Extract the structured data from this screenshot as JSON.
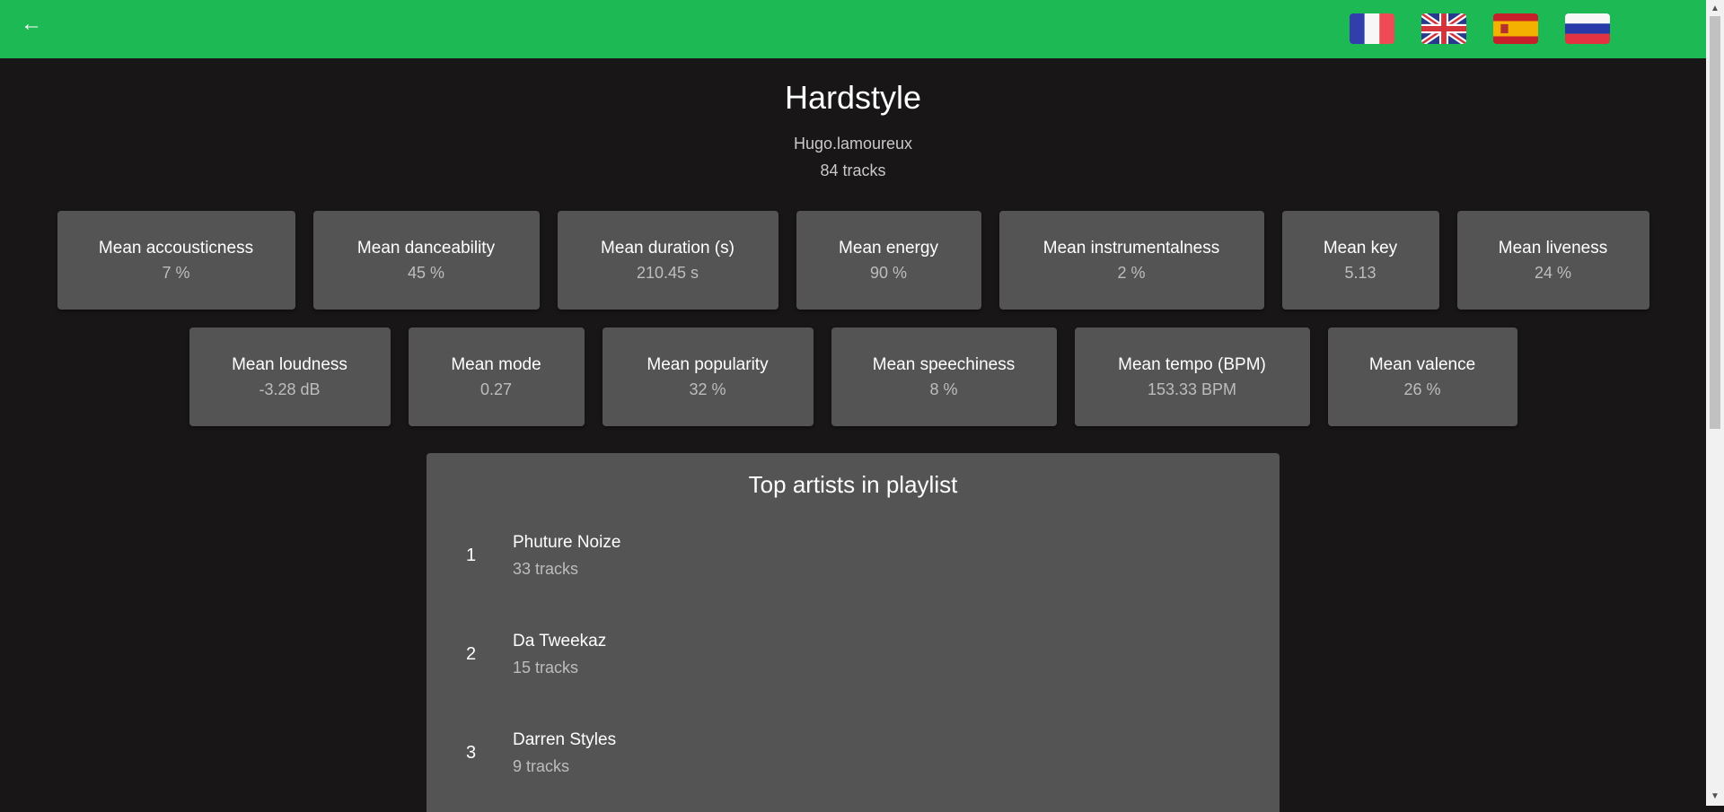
{
  "header": {
    "back_icon": "arrow-left-icon",
    "flags": [
      {
        "name": "french-flag-icon"
      },
      {
        "name": "uk-flag-icon"
      },
      {
        "name": "spanish-flag-icon"
      },
      {
        "name": "russian-flag-icon"
      }
    ],
    "color": "#1db954"
  },
  "playlist": {
    "title": "Hardstyle",
    "owner": "Hugo.lamoureux",
    "track_count": "84 tracks"
  },
  "stats_row1": [
    {
      "label": "Mean accousticness",
      "value": "7 %"
    },
    {
      "label": "Mean danceability",
      "value": "45 %"
    },
    {
      "label": "Mean duration (s)",
      "value": "210.45 s"
    },
    {
      "label": "Mean energy",
      "value": "90 %"
    },
    {
      "label": "Mean instrumentalness",
      "value": "2 %"
    },
    {
      "label": "Mean key",
      "value": "5.13"
    },
    {
      "label": "Mean liveness",
      "value": "24 %"
    }
  ],
  "stats_row2": [
    {
      "label": "Mean loudness",
      "value": "-3.28 dB"
    },
    {
      "label": "Mean mode",
      "value": "0.27"
    },
    {
      "label": "Mean popularity",
      "value": "32 %"
    },
    {
      "label": "Mean speechiness",
      "value": "8 %"
    },
    {
      "label": "Mean tempo (BPM)",
      "value": "153.33 BPM"
    },
    {
      "label": "Mean valence",
      "value": "26 %"
    }
  ],
  "top_artists": {
    "title": "Top artists in playlist",
    "items": [
      {
        "rank": "1",
        "name": "Phuture Noize",
        "tracks": "33 tracks"
      },
      {
        "rank": "2",
        "name": "Da Tweekaz",
        "tracks": "15 tracks"
      },
      {
        "rank": "3",
        "name": "Darren Styles",
        "tracks": "9 tracks"
      }
    ]
  },
  "colors": {
    "background": "#181616",
    "card": "#545454",
    "accent": "#1db954"
  }
}
